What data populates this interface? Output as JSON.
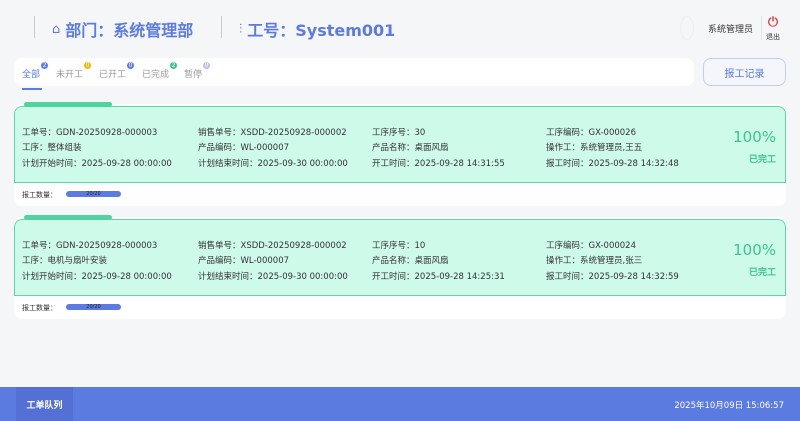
{
  "header": {
    "dept": "部门：系统管理部",
    "worker": "工号：System001",
    "user": "系统管理员",
    "logout": "退出",
    "home_icon": "home-icon",
    "sliders_icon": "sliders-icon",
    "power_icon": "power-icon"
  },
  "tabs": [
    {
      "label": "全部",
      "count": "2",
      "color": "#5b7be0"
    },
    {
      "label": "未开工",
      "count": "0",
      "color": "#f5b400"
    },
    {
      "label": "已开工",
      "count": "0",
      "color": "#5b7be0"
    },
    {
      "label": "已完成",
      "count": "2",
      "color": "#3cc48f"
    },
    {
      "label": "暂停",
      "count": "0",
      "color": "#b8c4f0"
    }
  ],
  "report_button": "报工记录",
  "orders": [
    {
      "f": [
        "工单号：GDN-20250928-000003",
        "销售单号：XSDD-20250928-000002",
        "工序序号：30",
        "工序编码：GX-000026",
        "工序：整体组装",
        "产品编码：WL-000007",
        "产品名称：桌面风扇",
        "操作工：系统管理员,王五",
        "计划开始时间：2025-09-28 00:00:00",
        "计划结束时间：2025-09-30 00:00:00",
        "开工时间：2025-09-28 14:31:55",
        "报工时间：2025-09-28 14:32:48"
      ],
      "percent": "100%",
      "status": "已完工",
      "qty_label": "报工数量：",
      "qty": "20/20",
      "progress": 1.0
    },
    {
      "f": [
        "工单号：GDN-20250928-000003",
        "销售单号：XSDD-20250928-000002",
        "工序序号：10",
        "工序编码：GX-000024",
        "工序：电机与扇叶安装",
        "产品编码：WL-000007",
        "产品名称：桌面风扇",
        "操作工：系统管理员,张三",
        "计划开始时间：2025-09-28 00:00:00",
        "计划结束时间：2025-09-30 00:00:00",
        "开工时间：2025-09-28 14:25:31",
        "报工时间：2025-09-28 14:32:59"
      ],
      "percent": "100%",
      "status": "已完工",
      "qty_label": "报工数量：",
      "qty": "20/20",
      "progress": 1.0
    }
  ],
  "footer": {
    "tab": "工单队列",
    "datetime": "2025年10月09日 15:06:57"
  }
}
